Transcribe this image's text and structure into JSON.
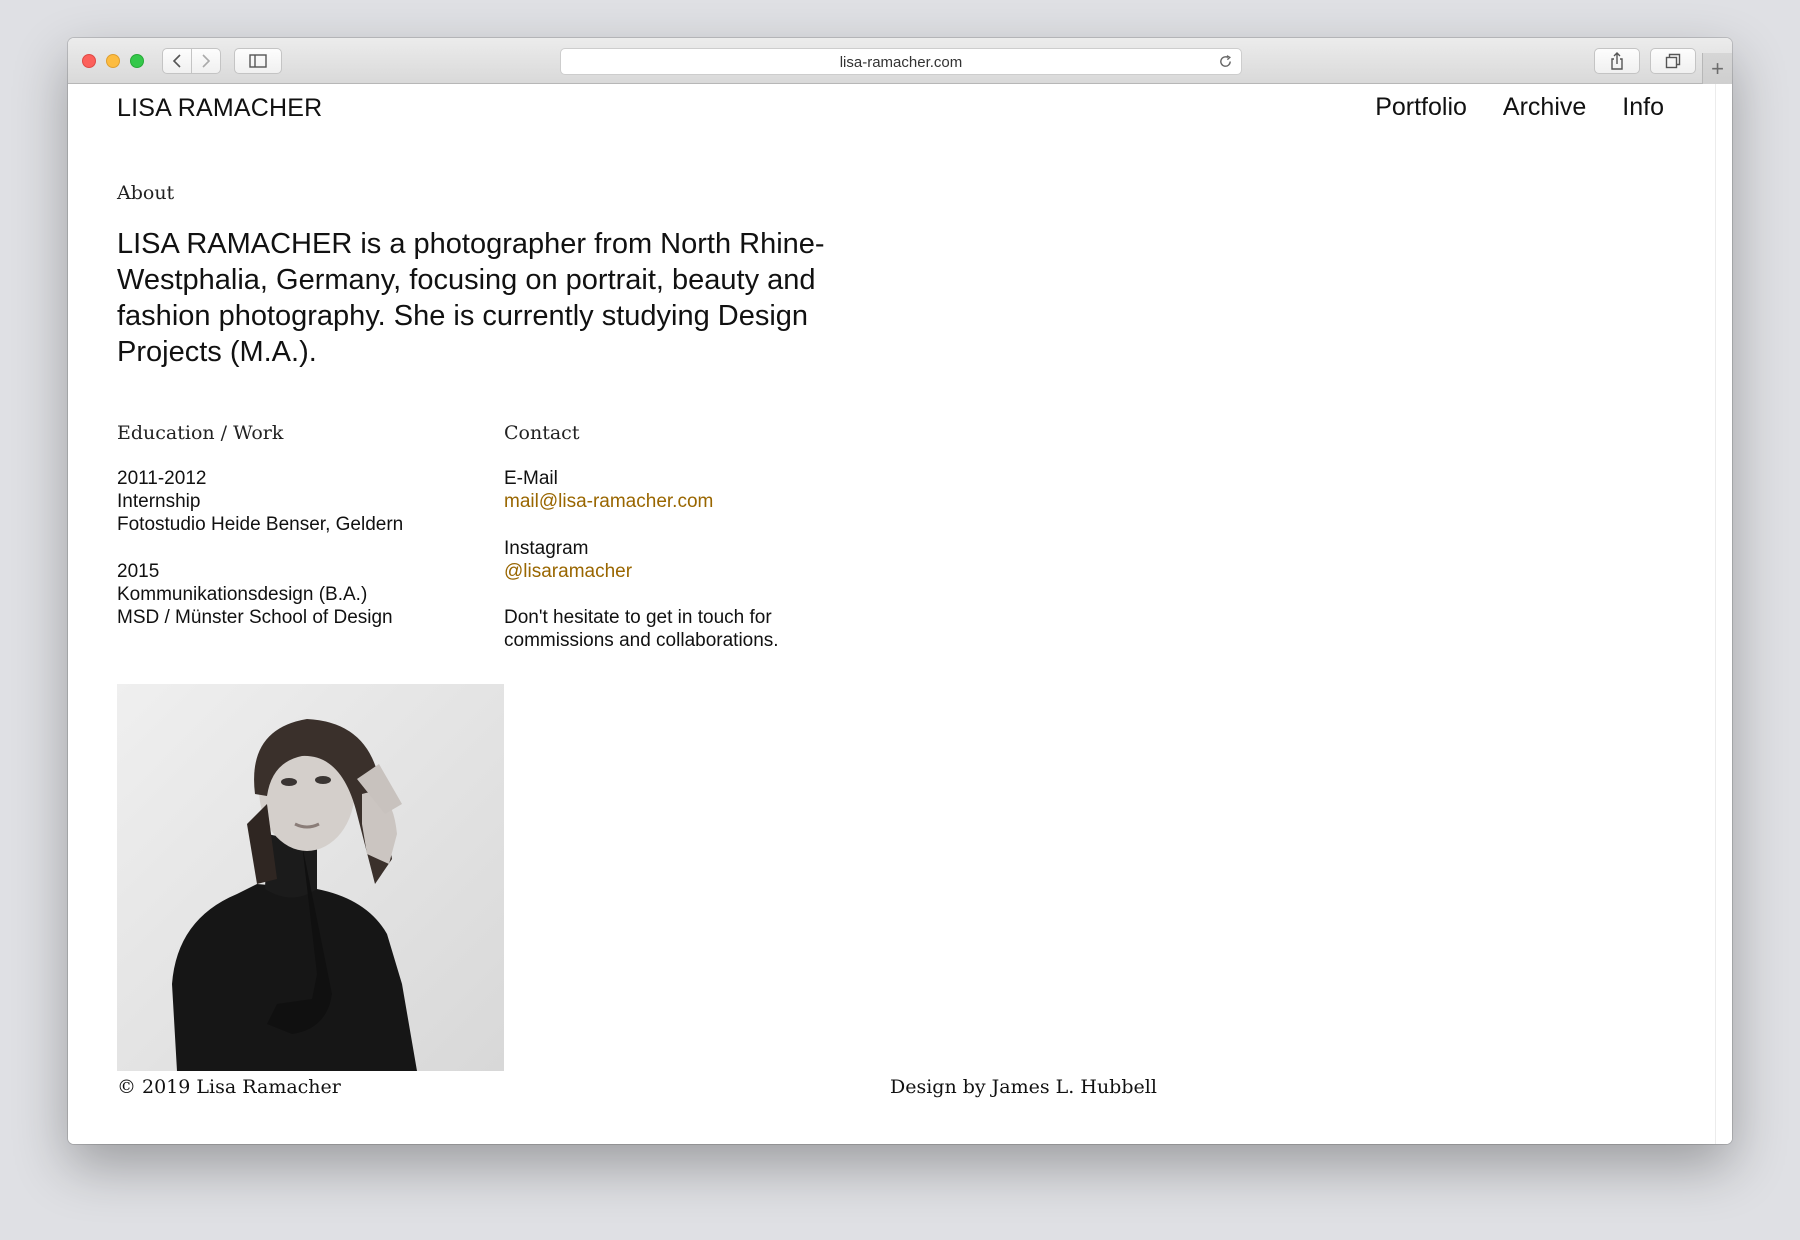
{
  "browser": {
    "url": "lisa-ramacher.com"
  },
  "site": {
    "title": "LISA RAMACHER",
    "nav": [
      "Portfolio",
      "Archive",
      "Info"
    ]
  },
  "about": {
    "label": "About",
    "text": "LISA RAMACHER is a photographer from North Rhine-Westphalia, Germany, focusing on portrait, beauty and fashion photography. She is currently studying Design Projects (M.A.)."
  },
  "education": {
    "label": "Education / Work",
    "entries": [
      {
        "years": "2011-2012",
        "title": "Internship",
        "place": "Fotostudio Heide Benser, Geldern"
      },
      {
        "years": "2015",
        "title": "Kommunikationsdesign (B.A.)",
        "place": "MSD / Münster School of Design"
      }
    ]
  },
  "contact": {
    "label": "Contact",
    "email_label": "E-Mail",
    "email": "mail@lisa-ramacher.com",
    "instagram_label": "Instagram",
    "instagram": "@lisaramacher",
    "note": "Don't hesitate to get in touch for commissions and collaborations."
  },
  "footer": {
    "copyright": "© 2019 Lisa Ramacher",
    "credit": "Design by James L. Hubbell"
  },
  "colors": {
    "link": "#996600",
    "text": "#111111",
    "background": "#ffffff"
  }
}
